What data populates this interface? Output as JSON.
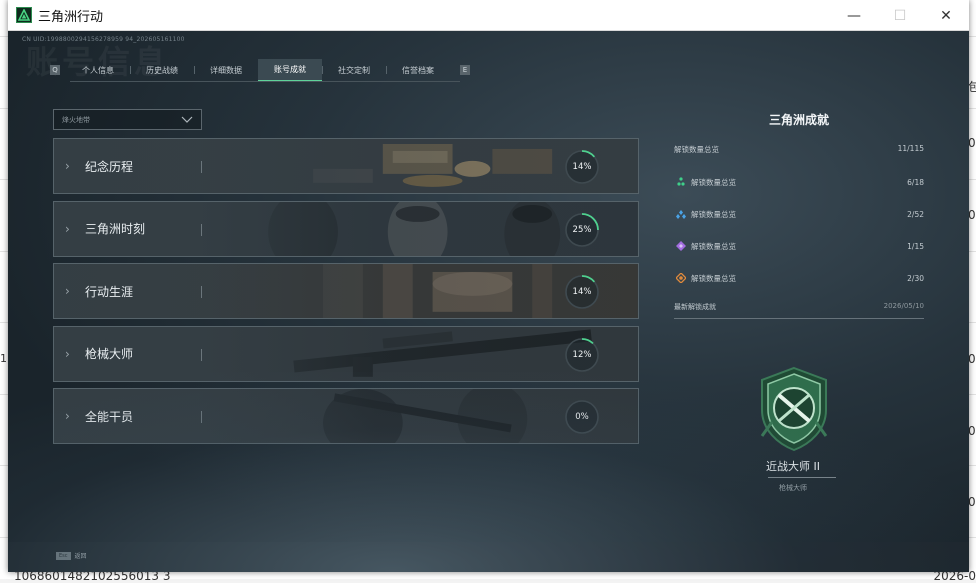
{
  "window": {
    "title": "三角洲行动",
    "icon_name": "delta-force-app-icon",
    "controls": [
      "minimize-icon",
      "maximize-icon",
      "close-icon"
    ]
  },
  "background_app": {
    "right_edge_texts": [
      "包",
      "0",
      "0",
      "0",
      "0",
      "0"
    ],
    "left_edge_text": "1",
    "bottom_left_text": "1068601482102556013 3",
    "bottom_right_text": "2026-0"
  },
  "header": {
    "uid": "CN UID:1998800294156278959 94_202605161100",
    "watermark": "账号信息"
  },
  "tabs": [
    {
      "label": "个人信息",
      "active": false
    },
    {
      "label": "历史战绩",
      "active": false
    },
    {
      "label": "详细数据",
      "active": false
    },
    {
      "label": "账号成就",
      "active": true
    },
    {
      "label": "社交定制",
      "active": false
    },
    {
      "label": "信誉档案",
      "active": false
    }
  ],
  "tab_arrows": {
    "left": "Q",
    "right": "E"
  },
  "filter": {
    "label": "烽火地带"
  },
  "categories": [
    {
      "label": "纪念历程",
      "percent": 14,
      "percent_text": "14%"
    },
    {
      "label": "三角洲时刻",
      "percent": 25,
      "percent_text": "25%"
    },
    {
      "label": "行动生涯",
      "percent": 14,
      "percent_text": "14%"
    },
    {
      "label": "枪械大师",
      "percent": 12,
      "percent_text": "12%"
    },
    {
      "label": "全能干员",
      "percent": 0,
      "percent_text": "0%"
    }
  ],
  "panel": {
    "title": "三角洲成就",
    "summary": {
      "label": "解锁数量总览",
      "count": "11/115"
    },
    "rows": [
      {
        "label": "解锁数量总览",
        "count": "6/18",
        "icon": "green-tier-icon",
        "color": "#3fd08a"
      },
      {
        "label": "解锁数量总览",
        "count": "2/52",
        "icon": "blue-tier-icon",
        "color": "#4aa3e6"
      },
      {
        "label": "解锁数量总览",
        "count": "1/15",
        "icon": "purple-tier-icon",
        "color": "#a36de0"
      },
      {
        "label": "解锁数量总览",
        "count": "2/30",
        "icon": "orange-tier-icon",
        "color": "#e08a3c"
      }
    ],
    "latest": {
      "label": "最新解锁成就",
      "date": "2026/05/10"
    },
    "badge": {
      "name": "近战大师 II",
      "category": "枪械大师",
      "icon": "melee-master-badge-icon"
    }
  },
  "footer": {
    "key": "Esc",
    "label": "返回"
  },
  "colors": {
    "accent": "#5fd39a",
    "ring_track": "#3f4a50",
    "ring_fill": "#4fd18f"
  }
}
